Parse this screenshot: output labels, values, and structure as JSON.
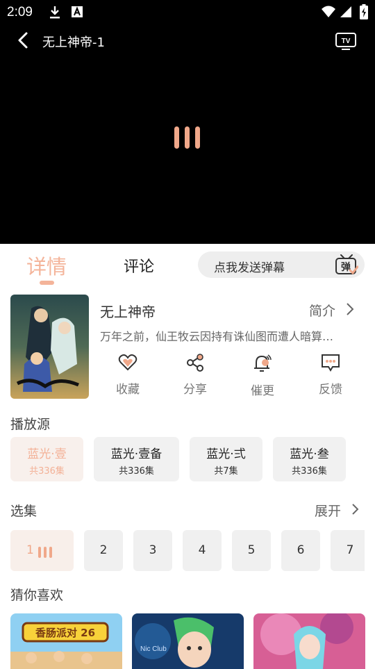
{
  "status_bar": {
    "time": "2:09",
    "icons": [
      "download-icon",
      "a11y-icon",
      "wifi-icon",
      "signal-icon",
      "battery-icon"
    ]
  },
  "player": {
    "title": "无上神帝-1",
    "icons": [
      "back-icon",
      "tv-cast-icon",
      "loading-bars-icon"
    ]
  },
  "tabs": {
    "details": "详情",
    "comments": "评论"
  },
  "danmaku": {
    "placeholder": "点我发送弹幕",
    "icon": "danmaku-icon",
    "icon_char": "弹"
  },
  "show": {
    "title": "无上神帝",
    "intro_label": "简介",
    "description": "万年之前，仙王牧云因持有诛仙图而遭人暗算…"
  },
  "actions": [
    {
      "label": "收藏",
      "icon": "heart-icon"
    },
    {
      "label": "分享",
      "icon": "share-icon"
    },
    {
      "label": "催更",
      "icon": "bell-icon"
    },
    {
      "label": "反馈",
      "icon": "feedback-icon"
    }
  ],
  "sources": {
    "heading": "播放源",
    "items": [
      {
        "name": "蓝光·壹",
        "count": "共336集",
        "active": true
      },
      {
        "name": "蓝光·壹备",
        "count": "共336集",
        "active": false
      },
      {
        "name": "蓝光·弍",
        "count": "共7集",
        "active": false
      },
      {
        "name": "蓝光·叁",
        "count": "共336集",
        "active": false
      }
    ]
  },
  "episodes": {
    "heading": "选集",
    "expand_label": "展开",
    "items": [
      "1",
      "2",
      "3",
      "4",
      "5",
      "6",
      "7"
    ],
    "active_index": 0
  },
  "recommend": {
    "heading": "猜你喜欢",
    "items": [
      {
        "label": "香肠派对 26"
      },
      {
        "label": "Nic Club"
      },
      {
        "label": ""
      }
    ]
  },
  "colors": {
    "accent": "#f4b49a",
    "player_bg": "#000000",
    "chip_bg": "#f1f1f1"
  }
}
